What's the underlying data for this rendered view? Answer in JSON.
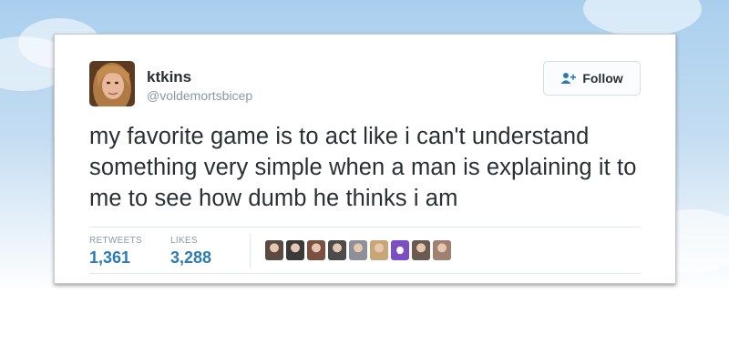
{
  "tweet": {
    "display_name": "ktkins",
    "handle": "@voldemortsbicep",
    "follow_label": "Follow",
    "text": "my favorite game is to act like i can't understand something very simple when a man is explaining it to me to see how dumb he thinks i am"
  },
  "stats": {
    "retweets_label": "RETWEETS",
    "retweets_value": "1,361",
    "likes_label": "LIKES",
    "likes_value": "3,288"
  },
  "likers": [
    {
      "icon": "liker-avatar",
      "color": "#5a4a42"
    },
    {
      "icon": "liker-avatar",
      "color": "#3a3a3a"
    },
    {
      "icon": "liker-avatar",
      "color": "#7a5140"
    },
    {
      "icon": "liker-avatar",
      "color": "#4c4c4c"
    },
    {
      "icon": "liker-avatar",
      "color": "#8d8f99"
    },
    {
      "icon": "liker-avatar",
      "color": "#c7a678"
    },
    {
      "icon": "liker-avatar",
      "color": "#7b4fc4"
    },
    {
      "icon": "liker-avatar",
      "color": "#6a5a52"
    },
    {
      "icon": "liker-avatar",
      "color": "#a08070"
    }
  ],
  "colors": {
    "link_blue": "#2b7bb9",
    "text_dark": "#292f33",
    "text_gray": "#8899a6"
  }
}
